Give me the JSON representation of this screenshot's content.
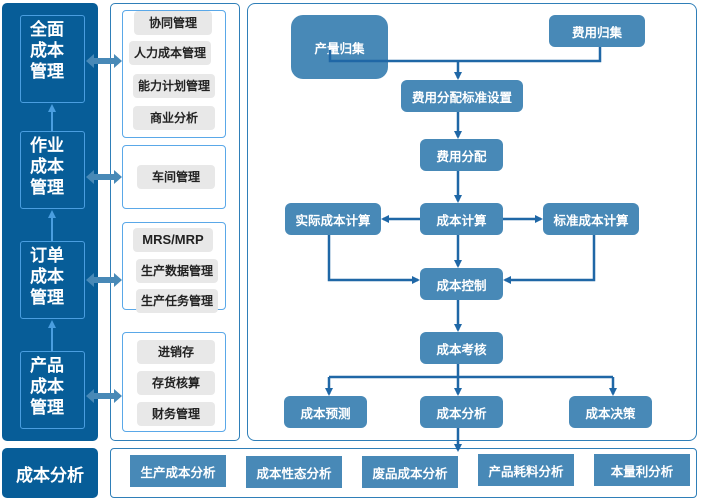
{
  "levels": [
    {
      "lines": [
        "全面",
        "成本",
        "管理"
      ]
    },
    {
      "lines": [
        "作业",
        "成本",
        "管理"
      ]
    },
    {
      "lines": [
        "订单",
        "成本",
        "管理"
      ]
    },
    {
      "lines": [
        "产品",
        "成本",
        "管理"
      ]
    }
  ],
  "bottom_left_label": "成本分析",
  "module_groups": [
    {
      "items": [
        "协同管理",
        "人力成本管理",
        "能力计划管理",
        "商业分析"
      ]
    },
    {
      "items": [
        "车间管理"
      ]
    },
    {
      "items": [
        "MRS/MRP",
        "生产数据管理",
        "生产任务管理"
      ]
    },
    {
      "items": [
        "进销存",
        "存货核算",
        "财务管理"
      ]
    }
  ],
  "flow": {
    "product_collection": "产量归集",
    "expense_collection": "费用归集",
    "allocation_standard": "费用分配标准设置",
    "allocation": "费用分配",
    "actual_cost_calc": "实际成本计算",
    "cost_calc": "成本计算",
    "standard_cost_calc": "标准成本计算",
    "cost_control": "成本控制",
    "cost_assessment": "成本考核",
    "cost_forecast": "成本预测",
    "cost_analysis": "成本分析",
    "cost_decision": "成本决策"
  },
  "analysis_items": [
    "生产成本分析",
    "成本性态分析",
    "废品成本分析",
    "产品耗料分析",
    "本量利分析"
  ],
  "colors": {
    "dark_blue": "#075d98",
    "node_blue": "#4889b7",
    "line_blue": "#1f67a6",
    "border_blue": "#2f7fb8",
    "pill_gray": "#e8e8e8"
  }
}
